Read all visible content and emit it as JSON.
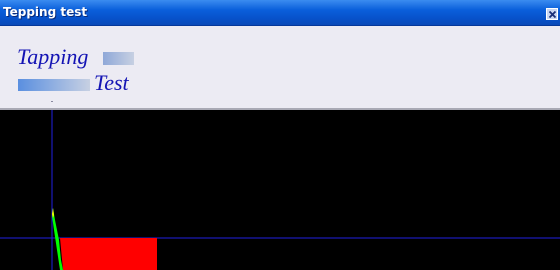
{
  "window": {
    "title": "Tepping test",
    "close_icon": "close-icon"
  },
  "logo": {
    "word1": "Tapping",
    "word2": "Test"
  },
  "chart_data": {
    "type": "area",
    "title": "",
    "xlabel": "",
    "ylabel": "",
    "grid": false,
    "colors": {
      "axis": "#2020e0",
      "fill": "#ff0000",
      "trace": "#00ff00",
      "trace_tip": "#ffff00",
      "background": "#000000"
    }
  }
}
